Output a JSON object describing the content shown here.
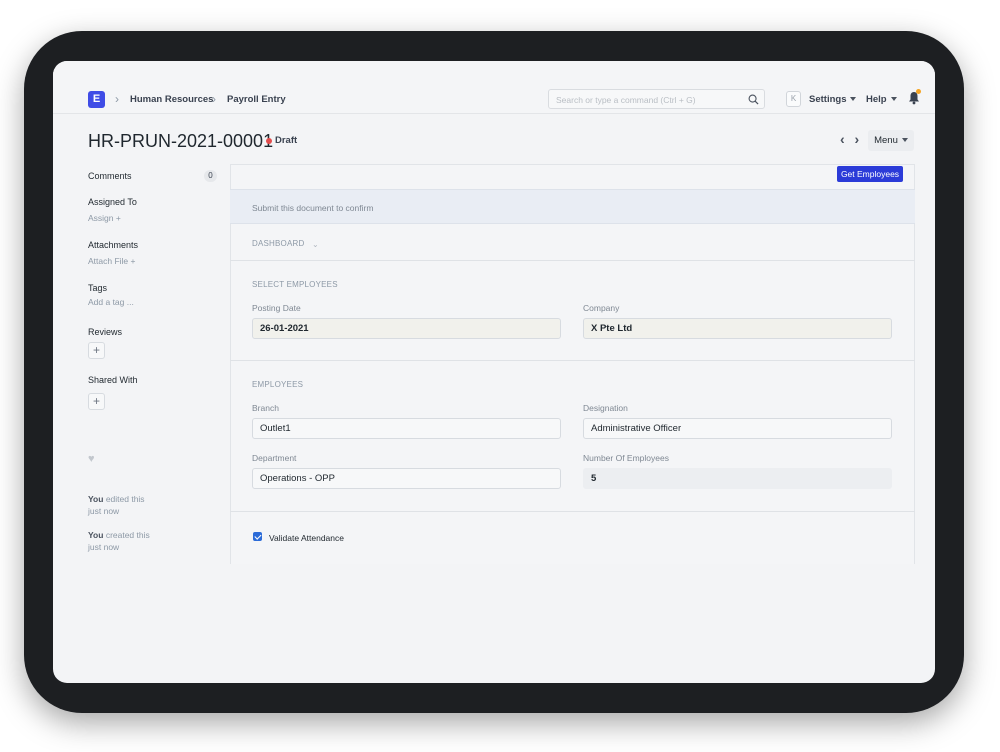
{
  "navbar": {
    "logo_letter": "E",
    "breadcrumbs": [
      "Human Resources",
      "Payroll Entry"
    ],
    "search_placeholder": "Search or type a command (Ctrl + G)",
    "avatar_letter": "K",
    "settings_label": "Settings",
    "help_label": "Help"
  },
  "header": {
    "title": "HR-PRUN-2021-00001",
    "status": "Draft",
    "nav_glyph": "‹ ›",
    "menu_label": "Menu"
  },
  "sidebar": {
    "comments_label": "Comments",
    "comments_count": "0",
    "assigned_to_label": "Assigned To",
    "assign_action": "Assign +",
    "attachments_label": "Attachments",
    "attach_action": "Attach File +",
    "tags_label": "Tags",
    "tags_action": "Add a tag ...",
    "reviews_label": "Reviews",
    "shared_with_label": "Shared With",
    "plus_glyph": "+",
    "heart_glyph": "♥",
    "activity": [
      {
        "who": "You",
        "action": "edited this",
        "when": "just now"
      },
      {
        "who": "You",
        "action": "created this",
        "when": "just now"
      }
    ]
  },
  "form": {
    "get_employees_label": "Get Employees",
    "message": "Submit this document to confirm",
    "dashboard_label": "DASHBOARD",
    "dashboard_chevron": "⌄",
    "select_employees": {
      "title": "SELECT EMPLOYEES",
      "posting_date_label": "Posting Date",
      "posting_date_value": "26-01-2021",
      "company_label": "Company",
      "company_value": "X Pte Ltd"
    },
    "employees": {
      "title": "EMPLOYEES",
      "branch_label": "Branch",
      "branch_value": "Outlet1",
      "designation_label": "Designation",
      "designation_value": "Administrative Officer",
      "department_label": "Department",
      "department_value": "Operations - OPP",
      "num_employees_label": "Number Of Employees",
      "num_employees_value": "5"
    },
    "validate_attendance_label": "Validate Attendance",
    "validate_attendance_checked": true
  },
  "colors": {
    "primary": "#2b3bd8",
    "logo": "#3f4ce6",
    "draft_indicator": "#e24c4c",
    "notification": "#f5a524"
  }
}
